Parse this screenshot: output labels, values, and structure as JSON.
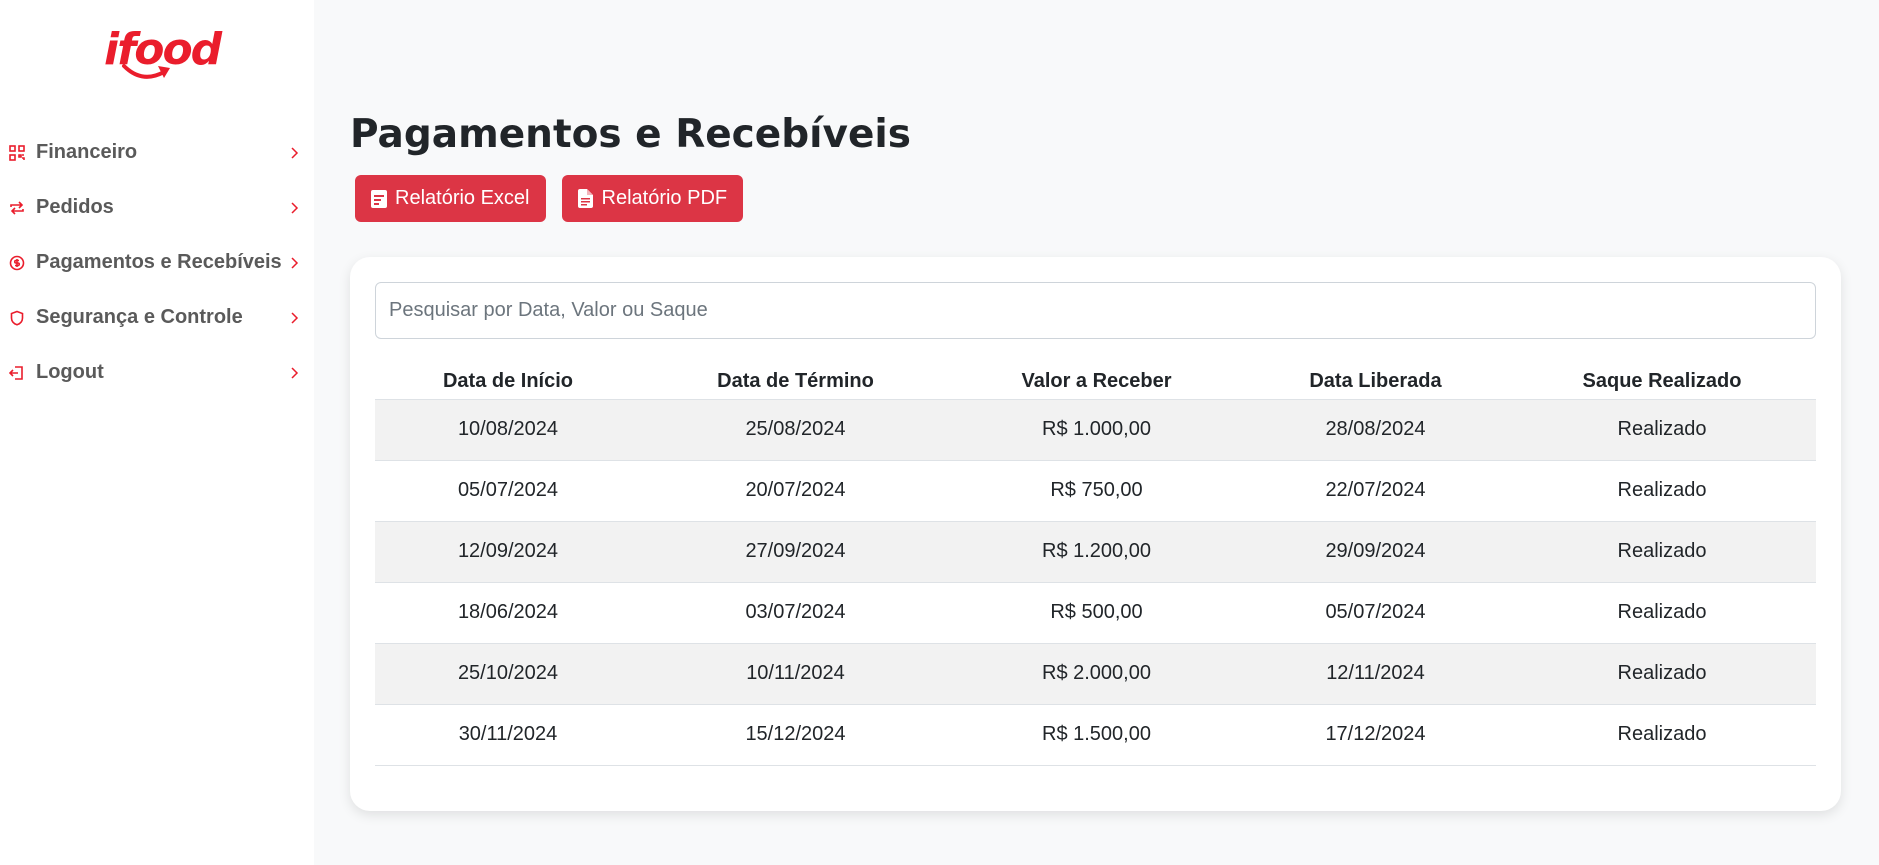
{
  "brand": {
    "logo_text": "ifood",
    "accent_color": "#ea1d2c",
    "button_color": "#dc3545"
  },
  "sidebar": {
    "items": [
      {
        "label": "Financeiro",
        "icon": "qr-grid-icon"
      },
      {
        "label": "Pedidos",
        "icon": "repeat-arrows-icon"
      },
      {
        "label": "Pagamentos e Recebíveis",
        "icon": "dollar-circle-icon"
      },
      {
        "label": "Segurança e Controle",
        "icon": "shield-icon"
      },
      {
        "label": "Logout",
        "icon": "logout-icon"
      }
    ]
  },
  "main": {
    "title": "Pagamentos e Recebíveis",
    "buttons": {
      "excel": "Relatório Excel",
      "pdf": "Relatório PDF"
    },
    "search": {
      "placeholder": "Pesquisar por Data, Valor ou Saque",
      "value": ""
    },
    "table": {
      "headers": [
        "Data de Início",
        "Data de Término",
        "Valor a Receber",
        "Data Liberada",
        "Saque Realizado"
      ],
      "rows": [
        [
          "10/08/2024",
          "25/08/2024",
          "R$ 1.000,00",
          "28/08/2024",
          "Realizado"
        ],
        [
          "05/07/2024",
          "20/07/2024",
          "R$ 750,00",
          "22/07/2024",
          "Realizado"
        ],
        [
          "12/09/2024",
          "27/09/2024",
          "R$ 1.200,00",
          "29/09/2024",
          "Realizado"
        ],
        [
          "18/06/2024",
          "03/07/2024",
          "R$ 500,00",
          "05/07/2024",
          "Realizado"
        ],
        [
          "25/10/2024",
          "10/11/2024",
          "R$ 2.000,00",
          "12/11/2024",
          "Realizado"
        ],
        [
          "30/11/2024",
          "15/12/2024",
          "R$ 1.500,00",
          "17/12/2024",
          "Realizado"
        ]
      ]
    }
  }
}
